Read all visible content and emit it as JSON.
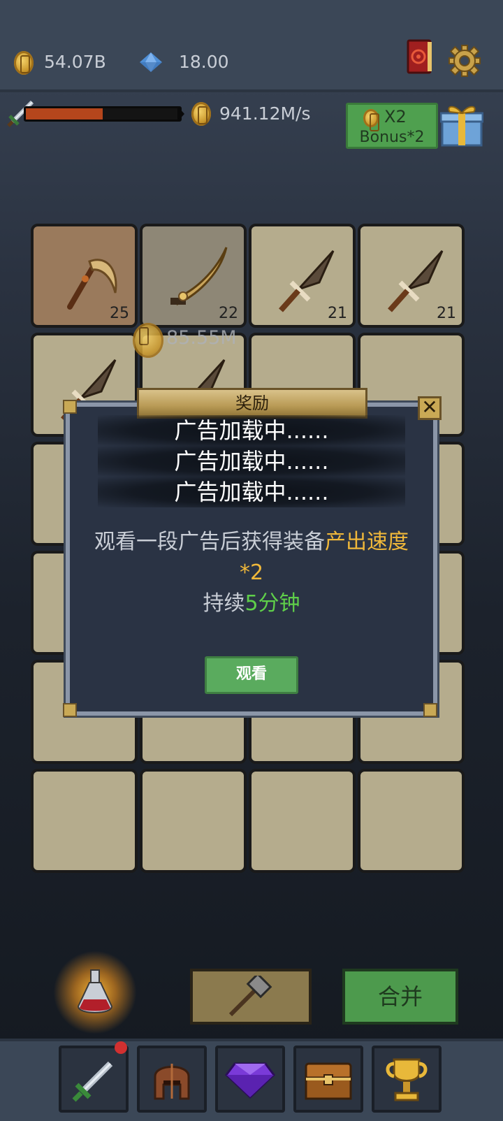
{
  "header": {
    "coins": "54.07B",
    "gems": "18.00"
  },
  "income": {
    "progress": 0.5,
    "rate": "941.12M/s"
  },
  "bonus": {
    "line1": "X2",
    "line2": "Bonus*2"
  },
  "grid": {
    "cells": [
      {
        "level": "25",
        "item": "scythe"
      },
      {
        "level": "22",
        "item": "scimitar"
      },
      {
        "level": "21",
        "item": "dagger"
      },
      {
        "level": "21",
        "item": "dagger"
      },
      {
        "level": "",
        "item": "dagger"
      },
      {
        "level": "",
        "item": "dagger"
      }
    ],
    "floating_coin_text": "85.55M"
  },
  "modal": {
    "title": "奖励",
    "ad_lines": [
      "广告加载中......",
      "广告加载中......",
      "广告加载中......"
    ],
    "desc_part1": "观看一段广告后获得装备",
    "desc_highlight": "产出速度*2",
    "duration_prefix": "持续",
    "duration_value": "5分钟",
    "watch_label": "观看",
    "close_label": "✕"
  },
  "actions": {
    "merge_label": "合并"
  },
  "nav": {
    "items": [
      "sword-icon",
      "helmet-icon",
      "gem-icon",
      "chest-icon",
      "trophy-icon"
    ]
  },
  "colors": {
    "accent_yellow": "#f0b83a",
    "accent_green": "#5fcf4a",
    "progress_red": "#b5461c",
    "bonus_green": "#4fa04f"
  }
}
